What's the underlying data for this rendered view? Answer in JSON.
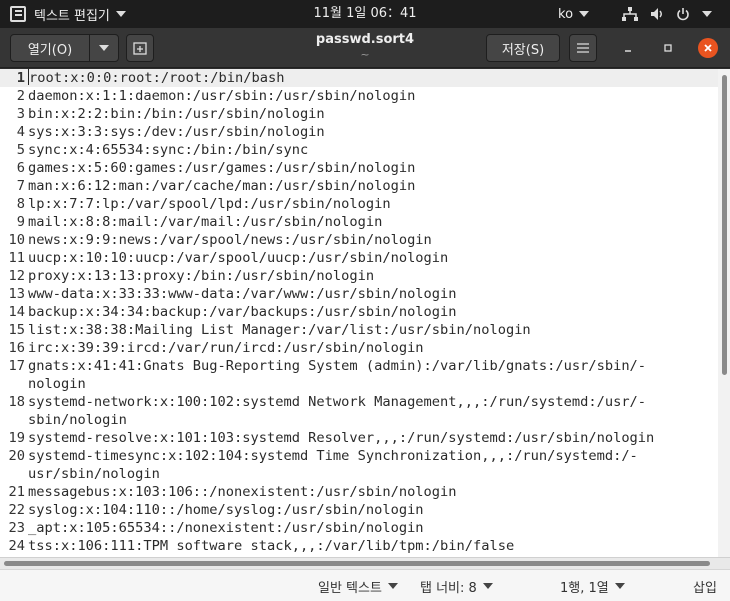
{
  "system": {
    "app_name": "텍스트 편집기",
    "clock": "11월 1일  06：41",
    "lang": "ko"
  },
  "header": {
    "open_label": "열기(O)",
    "title": "passwd.sort4",
    "subtitle": "~",
    "save_label": "저장(S)"
  },
  "editor": {
    "lines": [
      {
        "n": "1",
        "text": "root:x:0:0:root:/root:/bin/bash"
      },
      {
        "n": "2",
        "text": "daemon:x:1:1:daemon:/usr/sbin:/usr/sbin/nologin"
      },
      {
        "n": "3",
        "text": "bin:x:2:2:bin:/bin:/usr/sbin/nologin"
      },
      {
        "n": "4",
        "text": "sys:x:3:3:sys:/dev:/usr/sbin/nologin"
      },
      {
        "n": "5",
        "text": "sync:x:4:65534:sync:/bin:/bin/sync"
      },
      {
        "n": "6",
        "text": "games:x:5:60:games:/usr/games:/usr/sbin/nologin"
      },
      {
        "n": "7",
        "text": "man:x:6:12:man:/var/cache/man:/usr/sbin/nologin"
      },
      {
        "n": "8",
        "text": "lp:x:7:7:lp:/var/spool/lpd:/usr/sbin/nologin"
      },
      {
        "n": "9",
        "text": "mail:x:8:8:mail:/var/mail:/usr/sbin/nologin"
      },
      {
        "n": "10",
        "text": "news:x:9:9:news:/var/spool/news:/usr/sbin/nologin"
      },
      {
        "n": "11",
        "text": "uucp:x:10:10:uucp:/var/spool/uucp:/usr/sbin/nologin"
      },
      {
        "n": "12",
        "text": "proxy:x:13:13:proxy:/bin:/usr/sbin/nologin"
      },
      {
        "n": "13",
        "text": "www-data:x:33:33:www-data:/var/www:/usr/sbin/nologin"
      },
      {
        "n": "14",
        "text": "backup:x:34:34:backup:/var/backups:/usr/sbin/nologin"
      },
      {
        "n": "15",
        "text": "list:x:38:38:Mailing List Manager:/var/list:/usr/sbin/nologin"
      },
      {
        "n": "16",
        "text": "irc:x:39:39:ircd:/var/run/ircd:/usr/sbin/nologin"
      },
      {
        "n": "17",
        "text": "gnats:x:41:41:Gnats Bug-Reporting System (admin):/var/lib/gnats:/usr/sbin/-"
      },
      {
        "n": "",
        "text": "nologin"
      },
      {
        "n": "18",
        "text": "systemd-network:x:100:102:systemd Network Management,,,:/run/systemd:/usr/-"
      },
      {
        "n": "",
        "text": "sbin/nologin"
      },
      {
        "n": "19",
        "text": "systemd-resolve:x:101:103:systemd Resolver,,,:/run/systemd:/usr/sbin/nologin"
      },
      {
        "n": "20",
        "text": "systemd-timesync:x:102:104:systemd Time Synchronization,,,:/run/systemd:/-"
      },
      {
        "n": "",
        "text": "usr/sbin/nologin"
      },
      {
        "n": "21",
        "text": "messagebus:x:103:106::/nonexistent:/usr/sbin/nologin"
      },
      {
        "n": "22",
        "text": "syslog:x:104:110::/home/syslog:/usr/sbin/nologin"
      },
      {
        "n": "23",
        "text": "_apt:x:105:65534::/nonexistent:/usr/sbin/nologin"
      },
      {
        "n": "24",
        "text": "tss:x:106:111:TPM software stack,,,:/var/lib/tpm:/bin/false"
      }
    ]
  },
  "status": {
    "syntax": "일반 텍스트",
    "tab_width": "탭 너비: 8",
    "position": "1행, 1열",
    "mode": "삽입"
  },
  "colors": {
    "accent": "#e95420",
    "header_bg": "#353535",
    "topbar_bg": "#1d1d1d"
  }
}
